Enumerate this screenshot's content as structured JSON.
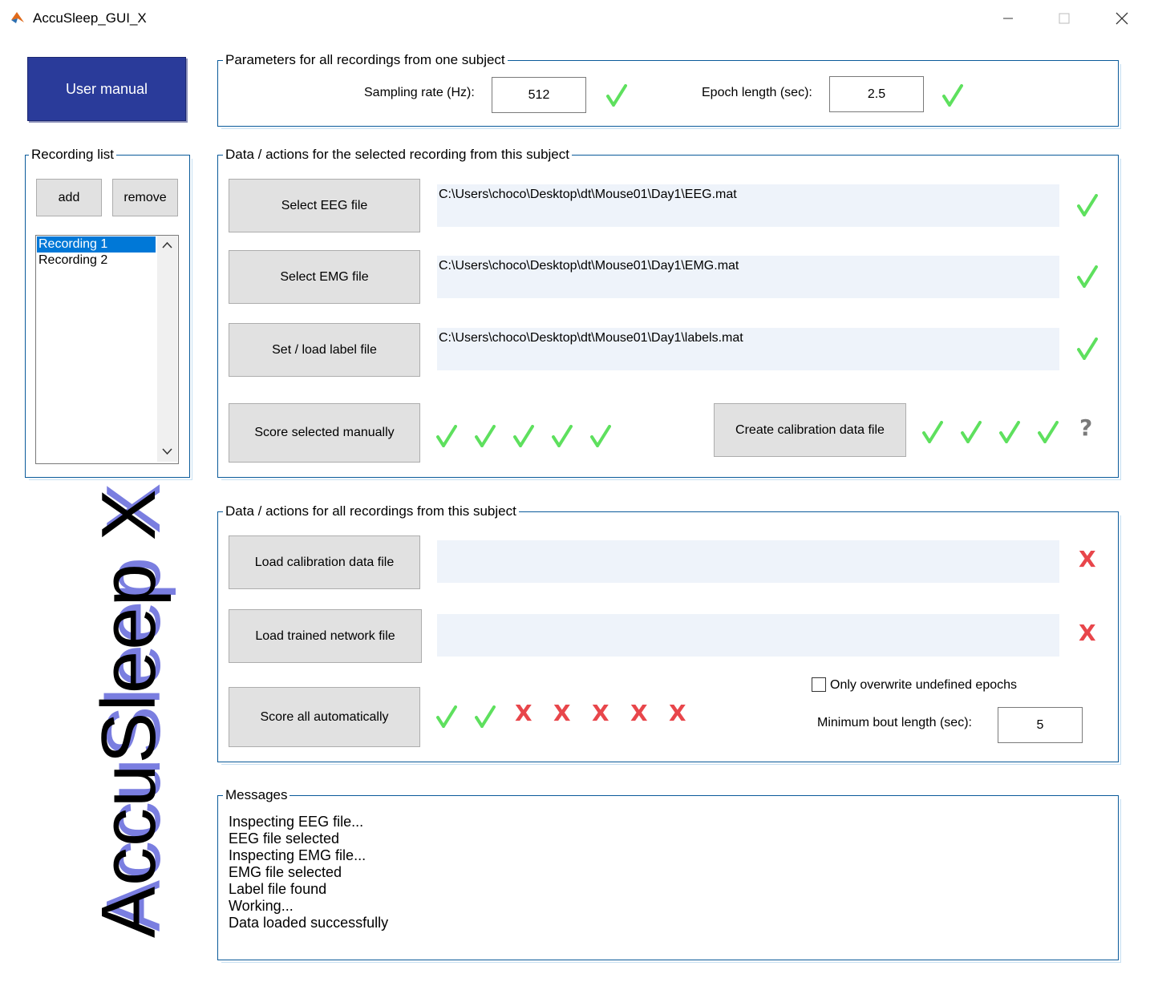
{
  "window": {
    "title": "AccuSleep_GUI_X"
  },
  "user_manual_label": "User manual",
  "params": {
    "title": "Parameters for all recordings from one subject",
    "sampling_label": "Sampling rate (Hz):",
    "sampling_value": "512",
    "epoch_label": "Epoch length (sec):",
    "epoch_value": "2.5"
  },
  "recording_list": {
    "title": "Recording list",
    "add_label": "add",
    "remove_label": "remove",
    "items": [
      "Recording 1",
      "Recording 2"
    ],
    "selected": "Recording 1"
  },
  "selected_recording": {
    "title": "Data / actions for the selected recording from this subject",
    "eeg_button": "Select EEG file",
    "eeg_path": "C:\\Users\\choco\\Desktop\\dt\\Mouse01\\Day1\\EEG.mat",
    "emg_button": "Select EMG file",
    "emg_path": "C:\\Users\\choco\\Desktop\\dt\\Mouse01\\Day1\\EMG.mat",
    "label_button": "Set / load label file",
    "label_path": "C:\\Users\\choco\\Desktop\\dt\\Mouse01\\Day1\\labels.mat",
    "score_manual_button": "Score selected manually",
    "calibration_button": "Create calibration data file",
    "calibration_unknown": "?"
  },
  "all_recordings": {
    "title": "Data / actions for all recordings from this subject",
    "load_calibration_button": "Load calibration data file",
    "load_network_button": "Load trained network file",
    "score_auto_button": "Score all automatically",
    "overwrite_label": "Only overwrite undefined epochs",
    "overwrite_checked": false,
    "min_bout_label": "Minimum bout length (sec):",
    "min_bout_value": "5",
    "cross_glyph": "X"
  },
  "messages": {
    "title": "Messages",
    "lines": [
      "Inspecting EEG file...",
      "EEG file selected",
      "Inspecting EMG file...",
      "EMG file selected",
      "Label file found",
      "Working...",
      "Data loaded successfully"
    ]
  },
  "brand": "AccuSleep X",
  "colors": {
    "check": "#5ee05e",
    "cross": "#e8464b",
    "accent": "#2a3b9a",
    "panel_border": "#0a5a9a"
  }
}
